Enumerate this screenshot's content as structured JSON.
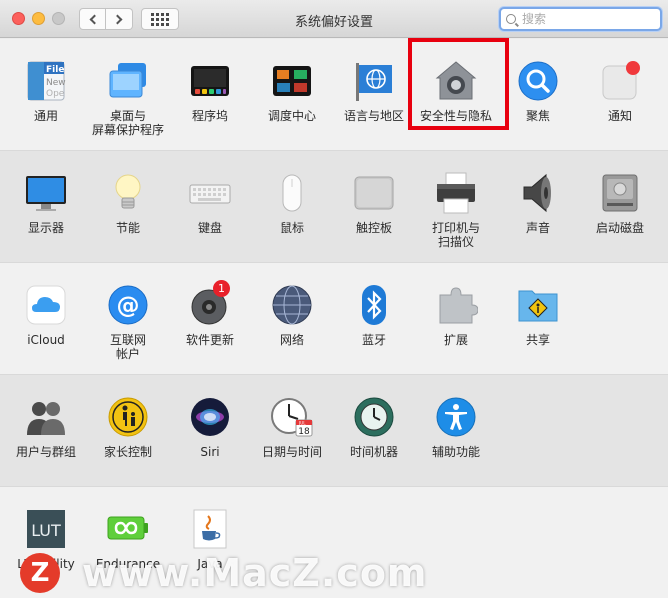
{
  "window": {
    "title": "系统偏好设置"
  },
  "toolbar": {
    "search_placeholder": "搜索"
  },
  "sections": {
    "row1": [
      {
        "label": "通用",
        "icon": "general-file-icon"
      },
      {
        "label": "桌面与\n屏幕保护程序",
        "icon": "desktop-screensaver-icon"
      },
      {
        "label": "程序坞",
        "icon": "dock-icon"
      },
      {
        "label": "调度中心",
        "icon": "mission-control-icon"
      },
      {
        "label": "语言与地区",
        "icon": "language-flag-icon"
      },
      {
        "label": "安全性与隐私",
        "icon": "security-house-icon"
      },
      {
        "label": "聚焦",
        "icon": "spotlight-icon"
      },
      {
        "label": "通知",
        "icon": "notifications-icon"
      }
    ],
    "row2": [
      {
        "label": "显示器",
        "icon": "display-icon"
      },
      {
        "label": "节能",
        "icon": "bulb-icon"
      },
      {
        "label": "键盘",
        "icon": "keyboard-icon"
      },
      {
        "label": "鼠标",
        "icon": "mouse-icon"
      },
      {
        "label": "触控板",
        "icon": "trackpad-icon"
      },
      {
        "label": "打印机与\n扫描仪",
        "icon": "printer-icon"
      },
      {
        "label": "声音",
        "icon": "speaker-icon"
      },
      {
        "label": "启动磁盘",
        "icon": "disk-icon"
      }
    ],
    "row3": [
      {
        "label": "iCloud",
        "icon": "icloud-icon"
      },
      {
        "label": "互联网\n帐户",
        "icon": "internet-accounts-icon"
      },
      {
        "label": "软件更新",
        "icon": "software-update-icon",
        "badge": "1"
      },
      {
        "label": "网络",
        "icon": "network-icon"
      },
      {
        "label": "蓝牙",
        "icon": "bluetooth-icon"
      },
      {
        "label": "扩展",
        "icon": "extensions-icon"
      },
      {
        "label": "共享",
        "icon": "sharing-icon"
      }
    ],
    "row4": [
      {
        "label": "用户与群组",
        "icon": "users-groups-icon"
      },
      {
        "label": "家长控制",
        "icon": "parental-controls-icon"
      },
      {
        "label": "Siri",
        "icon": "siri-icon"
      },
      {
        "label": "日期与时间",
        "icon": "date-time-icon",
        "calendar_day": "18",
        "calendar_month": "JUL"
      },
      {
        "label": "时间机器",
        "icon": "time-machine-icon"
      },
      {
        "label": "辅助功能",
        "icon": "accessibility-icon"
      }
    ],
    "row5": [
      {
        "label": "LUTUtility",
        "icon": "lut-utility-icon",
        "icon_text": "LUT"
      },
      {
        "label": "Endurance",
        "icon": "endurance-icon"
      },
      {
        "label": "Java",
        "icon": "java-icon"
      }
    ]
  },
  "general_icon_text": {
    "top": "File",
    "mid": "New",
    "bot": "Ope"
  },
  "watermark": {
    "text": "www.MacZ.com",
    "logo": "Z"
  },
  "colors": {
    "highlight": "#e8000f",
    "badge": "#e8202a",
    "search_border": "#7aa7e8"
  }
}
